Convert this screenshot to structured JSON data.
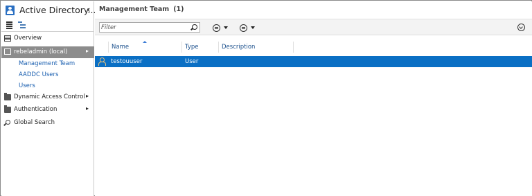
{
  "nav": {
    "app_title": "Active Directory...",
    "collapse_glyph": "‹",
    "items": {
      "overview": "Overview",
      "domain": "rebeladmin (local)",
      "sub_items": [
        "Management Team",
        "AADDC Users",
        "Users"
      ],
      "dynamic_access_control": "Dynamic Access Control",
      "authentication": "Authentication",
      "global_search": "Global Search"
    },
    "expand_glyph": "▸",
    "icons": {
      "app": "active-directory-icon",
      "list_view": "list-view-icon",
      "tree_view": "tree-view-icon",
      "overview": "grid-icon",
      "domain": "server-icon",
      "folder": "folder-icon",
      "search": "search-icon"
    }
  },
  "main": {
    "title": "Management Team",
    "count": "(1)",
    "toolbar": {
      "filter_placeholder": "Filter",
      "filter_value": "",
      "view_button_icon": "list-options-icon",
      "save_button_icon": "save-query-icon",
      "expand_icon": "chevron-down-circle-icon"
    },
    "columns": [
      "Name",
      "Type",
      "Description"
    ],
    "rows": [
      {
        "name": "testouuser",
        "type": "User",
        "description": "",
        "icon": "user-icon",
        "selected": true
      }
    ]
  },
  "colors": {
    "selection": "#0a6fc4",
    "domain_row": "#8c8c8c",
    "link": "#1a5fb0",
    "toolbar": "#f3f3f3"
  }
}
